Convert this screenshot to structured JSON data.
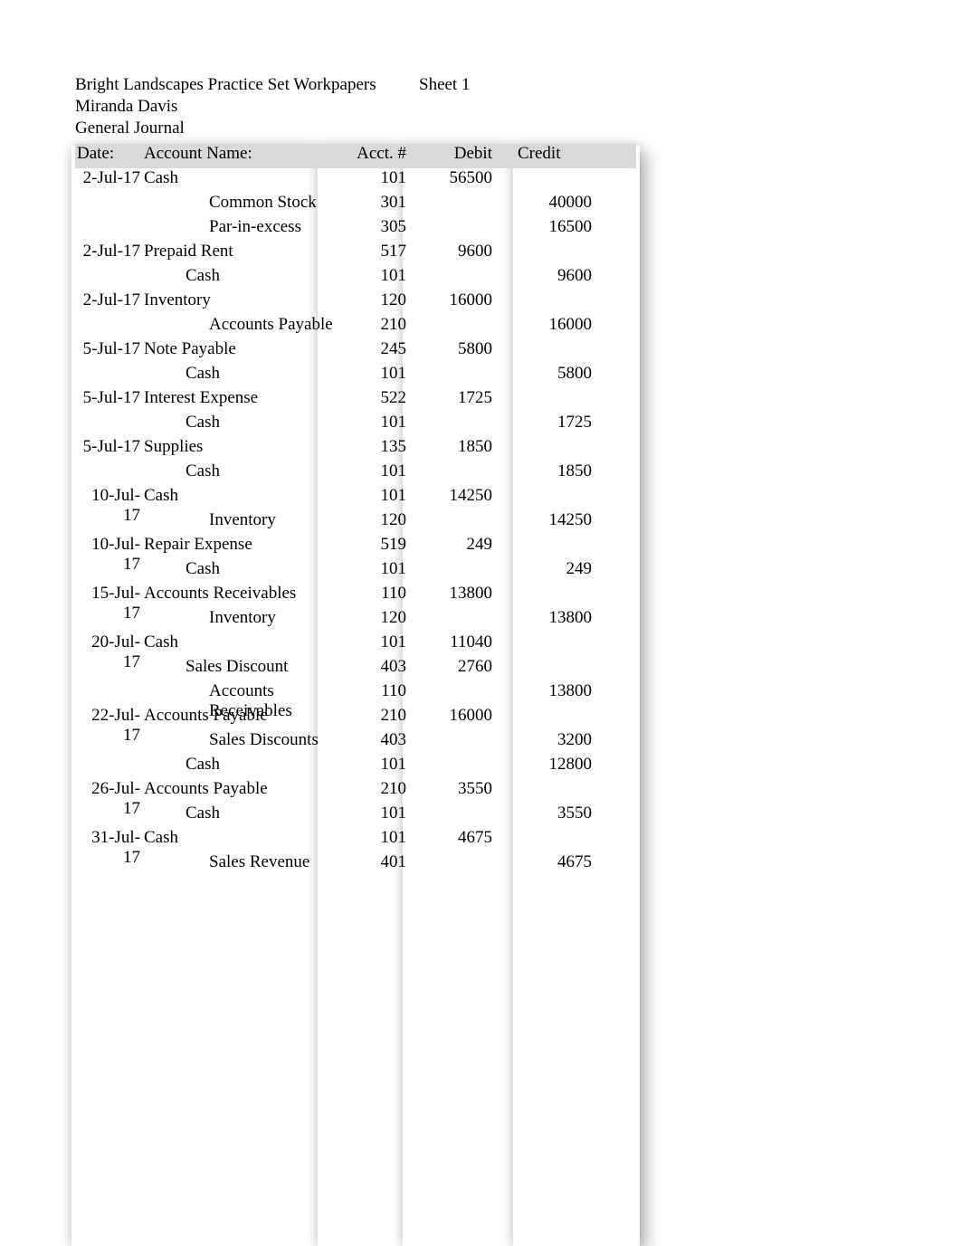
{
  "header": {
    "title": "Bright Landscapes Practice Set Workpapers",
    "sheet": "Sheet 1",
    "author": "Miranda Davis",
    "subtitle": "General Journal"
  },
  "columns": {
    "date": "Date:",
    "account": "Account Name:",
    "acct_num": "Acct. #",
    "debit": "Debit",
    "credit": "Credit"
  },
  "rows": [
    {
      "date": "2-Jul-17",
      "account": "Cash",
      "indent": 0,
      "acct": "101",
      "debit": "56500",
      "credit": ""
    },
    {
      "date": "",
      "account": "Common Stock",
      "indent": 2,
      "acct": "301",
      "debit": "",
      "credit": "40000"
    },
    {
      "date": "",
      "account": "Par-in-excess",
      "indent": 2,
      "acct": "305",
      "debit": "",
      "credit": "16500"
    },
    {
      "date": "2-Jul-17",
      "account": "Prepaid Rent",
      "indent": 0,
      "acct": "517",
      "debit": "9600",
      "credit": ""
    },
    {
      "date": "",
      "account": "Cash",
      "indent": 1,
      "acct": "101",
      "debit": "",
      "credit": "9600"
    },
    {
      "date": "2-Jul-17",
      "account": "Inventory",
      "indent": 0,
      "acct": "120",
      "debit": "16000",
      "credit": ""
    },
    {
      "date": "",
      "account": "Accounts Payable",
      "indent": 2,
      "acct": "210",
      "debit": "",
      "credit": "16000"
    },
    {
      "date": "5-Jul-17",
      "account": "Note Payable",
      "indent": 0,
      "acct": "245",
      "debit": "5800",
      "credit": ""
    },
    {
      "date": "",
      "account": "Cash",
      "indent": 1,
      "acct": "101",
      "debit": "",
      "credit": "5800"
    },
    {
      "date": "5-Jul-17",
      "account": "Interest Expense",
      "indent": 0,
      "acct": "522",
      "debit": "1725",
      "credit": ""
    },
    {
      "date": "",
      "account": "Cash",
      "indent": 1,
      "acct": "101",
      "debit": "",
      "credit": "1725"
    },
    {
      "date": "5-Jul-17",
      "account": "Supplies",
      "indent": 0,
      "acct": "135",
      "debit": "1850",
      "credit": ""
    },
    {
      "date": "",
      "account": "Cash",
      "indent": 1,
      "acct": "101",
      "debit": "",
      "credit": "1850"
    },
    {
      "date": "10-Jul-17",
      "account": "Cash",
      "indent": 0,
      "acct": "101",
      "debit": "14250",
      "credit": ""
    },
    {
      "date": "",
      "account": "Inventory",
      "indent": 2,
      "acct": "120",
      "debit": "",
      "credit": "14250"
    },
    {
      "date": "10-Jul-17",
      "account": "Repair Expense",
      "indent": 0,
      "acct": "519",
      "debit": "249",
      "credit": ""
    },
    {
      "date": "",
      "account": "Cash",
      "indent": 1,
      "acct": "101",
      "debit": "",
      "credit": "249"
    },
    {
      "date": "15-Jul-17",
      "account": "Accounts Receivables",
      "indent": 0,
      "acct": "110",
      "debit": "13800",
      "credit": ""
    },
    {
      "date": "",
      "account": "Inventory",
      "indent": 2,
      "acct": "120",
      "debit": "",
      "credit": "13800"
    },
    {
      "date": "20-Jul-17",
      "account": "Cash",
      "indent": 0,
      "acct": "101",
      "debit": "11040",
      "credit": ""
    },
    {
      "date": "",
      "account": "Sales Discount",
      "indent": 1,
      "acct": "403",
      "debit": "2760",
      "credit": ""
    },
    {
      "date": "",
      "account": "Accounts Receivables",
      "indent": 2,
      "acct": "110",
      "debit": "",
      "credit": "13800"
    },
    {
      "date": "22-Jul-17",
      "account": "Accounts Payable",
      "indent": 0,
      "acct": "210",
      "debit": "16000",
      "credit": ""
    },
    {
      "date": "",
      "account": "Sales Discounts",
      "indent": 2,
      "acct": "403",
      "debit": "",
      "credit": "3200"
    },
    {
      "date": "",
      "account": "Cash",
      "indent": 1,
      "acct": "101",
      "debit": "",
      "credit": "12800"
    },
    {
      "date": "26-Jul-17",
      "account": "Accounts Payable",
      "indent": 0,
      "acct": "210",
      "debit": "3550",
      "credit": ""
    },
    {
      "date": "",
      "account": "Cash",
      "indent": 1,
      "acct": "101",
      "debit": "",
      "credit": "3550"
    },
    {
      "date": "31-Jul-17",
      "account": "Cash",
      "indent": 0,
      "acct": "101",
      "debit": "4675",
      "credit": ""
    },
    {
      "date": "",
      "account": "Sales Revenue",
      "indent": 2,
      "acct": "401",
      "debit": "",
      "credit": "4675"
    }
  ]
}
